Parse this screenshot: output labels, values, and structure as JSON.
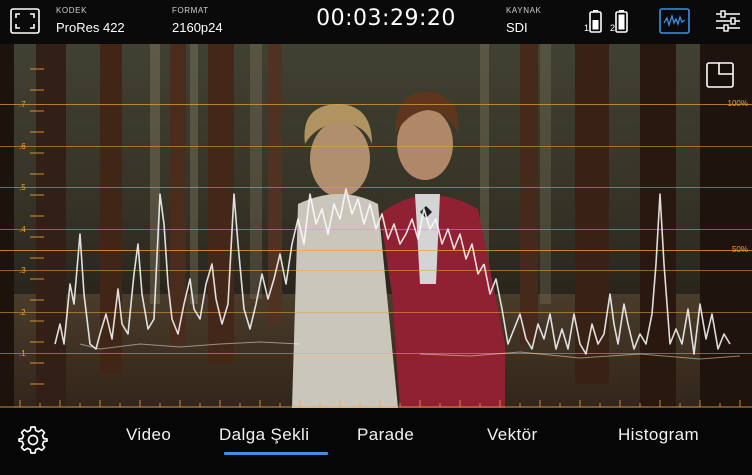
{
  "topbar": {
    "codec": {
      "label": "KODEK",
      "value": "ProRes 422"
    },
    "format": {
      "label": "FORMAT",
      "value": "2160p24"
    },
    "timecode": "00:03:29:20",
    "source": {
      "label": "KAYNAK",
      "value": "SDI"
    },
    "battery_1": "1",
    "battery_2": "2",
    "icons": [
      "fullscreen-frame-icon",
      "battery-icon",
      "waveform-icon",
      "sliders-icon"
    ],
    "accent_color": "#3f8fe6"
  },
  "scope": {
    "scale_labels": [
      ".7",
      ".6",
      ".5",
      ".4",
      ".3",
      ".2",
      ".1"
    ],
    "percent_high": "100%",
    "percent_mid": "50%",
    "graticule_color": "#f0a23a"
  },
  "tabs": [
    {
      "label": "Video",
      "selected": false
    },
    {
      "label": "Dalga Şekli",
      "selected": true
    },
    {
      "label": "Parade",
      "selected": false
    },
    {
      "label": "Vektör",
      "selected": false
    },
    {
      "label": "Histogram",
      "selected": false
    }
  ]
}
